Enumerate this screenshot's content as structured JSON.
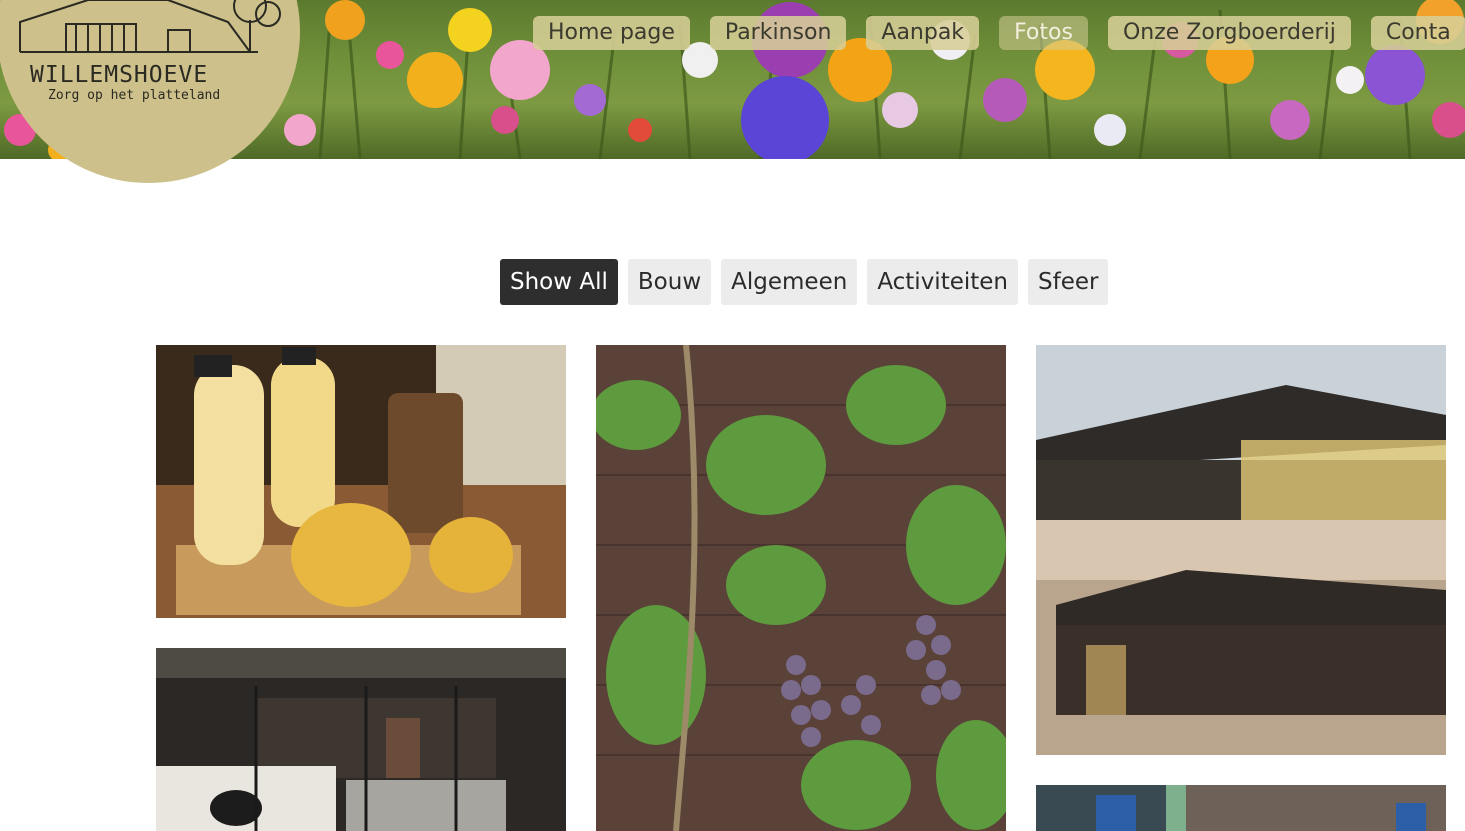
{
  "brand": {
    "name": "WILLEMSHOEVE",
    "tagline": "Zorg op het platteland"
  },
  "nav": {
    "items": [
      {
        "label": "Home page",
        "active": false
      },
      {
        "label": "Parkinson",
        "active": false
      },
      {
        "label": "Aanpak",
        "active": false
      },
      {
        "label": "Fotos",
        "active": true
      },
      {
        "label": "Onze Zorgboerderij",
        "active": false
      },
      {
        "label": "Conta",
        "active": false
      }
    ]
  },
  "filters": {
    "items": [
      {
        "label": "Show All",
        "active": true
      },
      {
        "label": "Bouw",
        "active": false
      },
      {
        "label": "Algemeen",
        "active": false
      },
      {
        "label": "Activiteiten",
        "active": false
      },
      {
        "label": "Sfeer",
        "active": false
      }
    ]
  },
  "colors": {
    "logo_disc": "#cdc08b",
    "nav_pill": "#d6ce96",
    "filter_active_bg": "#2e2e2e",
    "filter_bg": "#ececec"
  },
  "gallery": {
    "photos": [
      {
        "subject": "milk-bottles-cheese-granola"
      },
      {
        "subject": "grape-vine-on-wall"
      },
      {
        "subject": "farm-building-render"
      },
      {
        "subject": "cow-barn"
      },
      {
        "subject": "construction-site"
      }
    ]
  }
}
